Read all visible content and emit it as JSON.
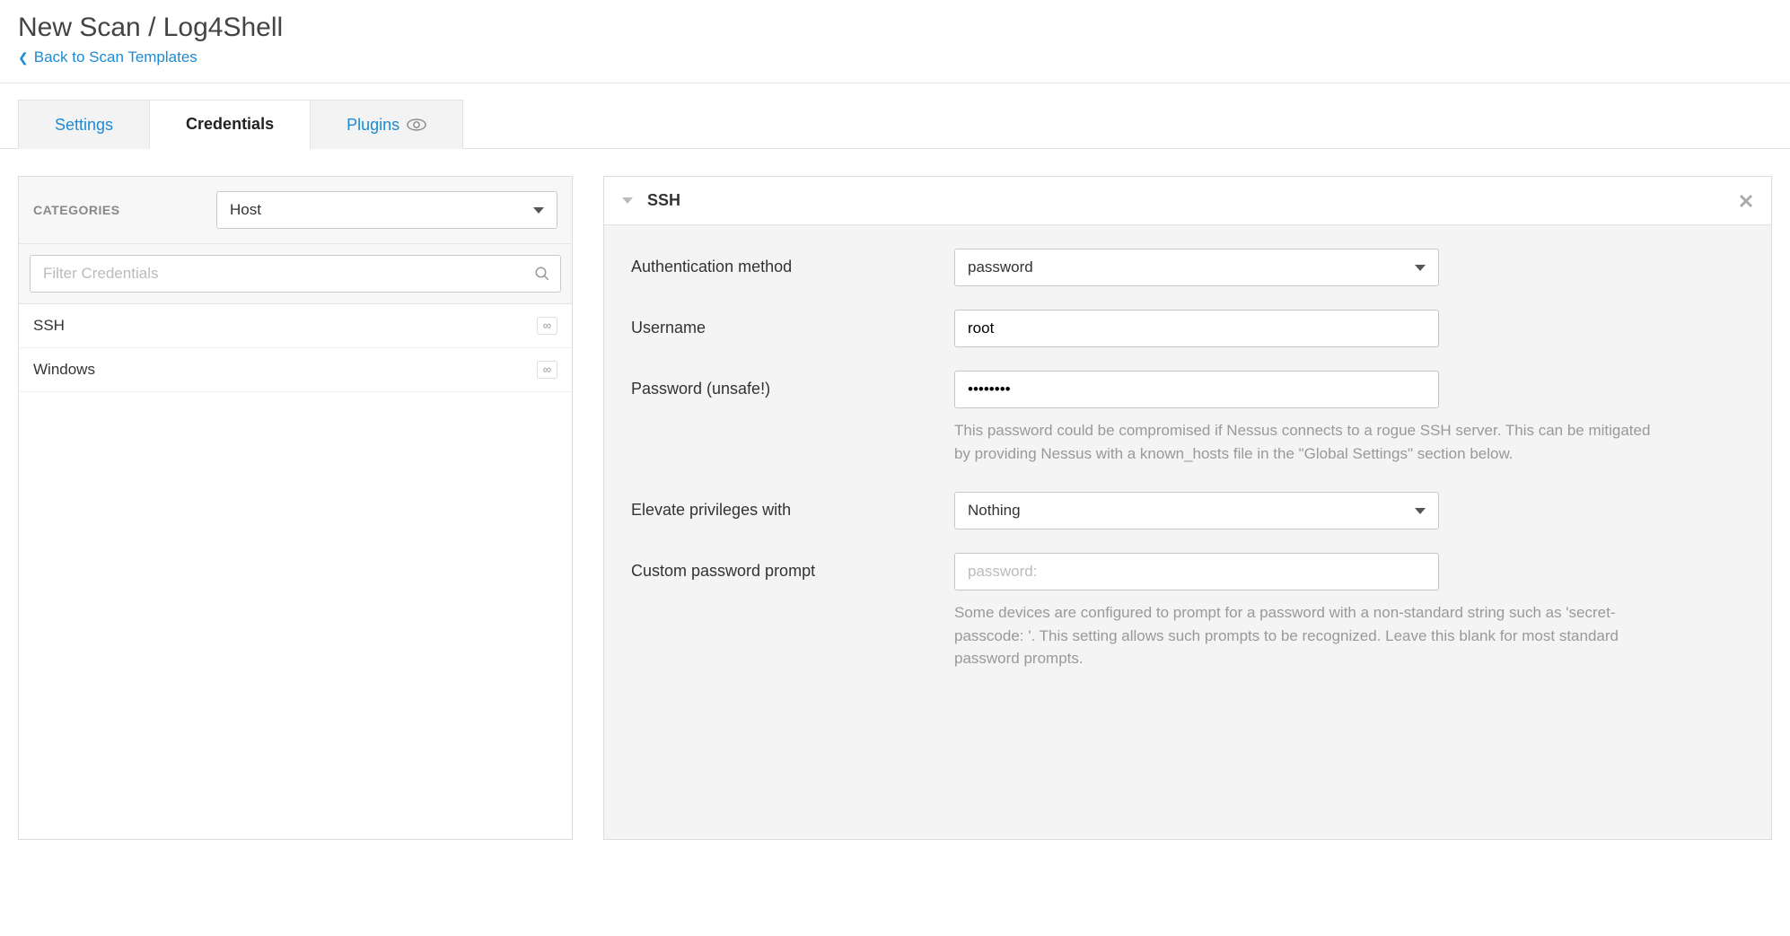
{
  "header": {
    "title": "New Scan / Log4Shell",
    "back_link": "Back to Scan Templates"
  },
  "tabs": {
    "settings": "Settings",
    "credentials": "Credentials",
    "plugins": "Plugins"
  },
  "left": {
    "categories_label": "CATEGORIES",
    "category_selected": "Host",
    "filter_placeholder": "Filter Credentials",
    "items": [
      {
        "label": "SSH",
        "badge": "∞"
      },
      {
        "label": "Windows",
        "badge": "∞"
      }
    ]
  },
  "right": {
    "title": "SSH",
    "fields": {
      "auth_method": {
        "label": "Authentication method",
        "value": "password"
      },
      "username": {
        "label": "Username",
        "value": "root"
      },
      "password": {
        "label": "Password (unsafe!)",
        "value": "••••••••",
        "help": "This password could be compromised if Nessus connects to a rogue SSH server. This can be mitigated by providing Nessus with a known_hosts file in the \"Global Settings\" section below."
      },
      "elevate": {
        "label": "Elevate privileges with",
        "value": "Nothing"
      },
      "custom_prompt": {
        "label": "Custom password prompt",
        "placeholder": "password:",
        "help": "Some devices are configured to prompt for a password with a non-standard string such as 'secret-passcode: '. This setting allows such prompts to be recognized. Leave this blank for most standard password prompts."
      }
    }
  }
}
